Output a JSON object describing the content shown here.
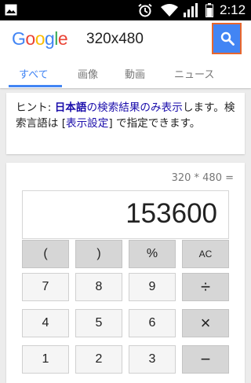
{
  "status_bar": {
    "time": "2:12",
    "icons": [
      "image-icon",
      "alarm-icon",
      "wifi-icon",
      "signal-icon",
      "battery-icon"
    ]
  },
  "search": {
    "logo": [
      "G",
      "o",
      "o",
      "g",
      "l",
      "e"
    ],
    "query": "320x480",
    "tabs": [
      "すべて",
      "画像",
      "動画",
      "ニュース"
    ],
    "active_tab": "すべて"
  },
  "hint": {
    "prefix": "ヒント: ",
    "lang_link": "日本語",
    "middle_link": "の検索結果のみ表示",
    "line_rest": "します。検索言語は [",
    "settings_link": "表示設定",
    "suffix": "] で指定できます。"
  },
  "calculator": {
    "expression": "320 * 480 =",
    "result": "153600",
    "keys": [
      [
        "(",
        ")",
        "%",
        "AC"
      ],
      [
        "7",
        "8",
        "9",
        "÷"
      ],
      [
        "4",
        "5",
        "6",
        "×"
      ],
      [
        "1",
        "2",
        "3",
        "−"
      ]
    ]
  },
  "colors": {
    "accent": "#4285f4",
    "link": "#1a0dab",
    "search_button_border": "#e8662d"
  }
}
